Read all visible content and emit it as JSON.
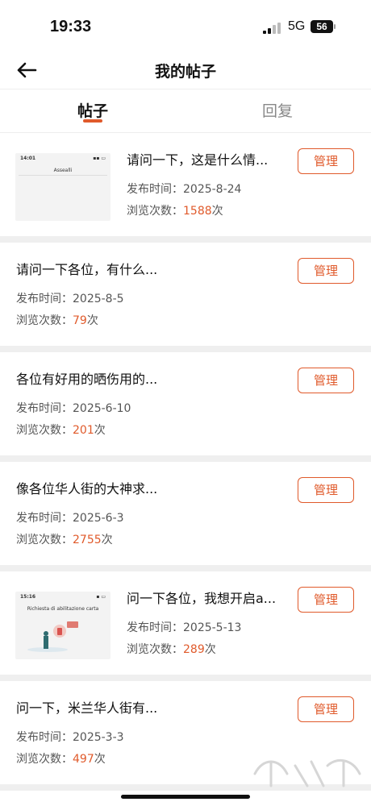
{
  "status_bar": {
    "time": "19:33",
    "network": "5G",
    "battery": "56"
  },
  "header": {
    "title": "我的帖子",
    "back_icon": "arrow-left-icon"
  },
  "tabs": [
    {
      "label": "帖子",
      "active": true
    },
    {
      "label": "回复",
      "active": false
    }
  ],
  "labels": {
    "date_prefix": "发布时间：",
    "views_prefix": "浏览次数：",
    "views_suffix": "次",
    "manage": "管理"
  },
  "thumb1": {
    "status_time": "14:01",
    "caption": "Assealli"
  },
  "thumb2": {
    "status_time": "15:16",
    "caption": "Richiesta di abilitazione carta"
  },
  "posts": [
    {
      "title": "请问一下，这是什么情...",
      "date": "2025-8-24",
      "views": "1588"
    },
    {
      "title": "请问一下各位，有什么...",
      "date": "2025-8-5",
      "views": "79"
    },
    {
      "title": "各位有好用的晒伤用的...",
      "date": "2025-6-10",
      "views": "201"
    },
    {
      "title": "像各位华人街的大神求...",
      "date": "2025-6-3",
      "views": "2755"
    },
    {
      "title": "问一下各位，我想开启a...",
      "date": "2025-5-13",
      "views": "289"
    },
    {
      "title": "问一下，米兰华人街有...",
      "date": "2025-3-3",
      "views": "497"
    }
  ],
  "colors": {
    "accent": "#e05a2b",
    "separator": "#efefef"
  }
}
